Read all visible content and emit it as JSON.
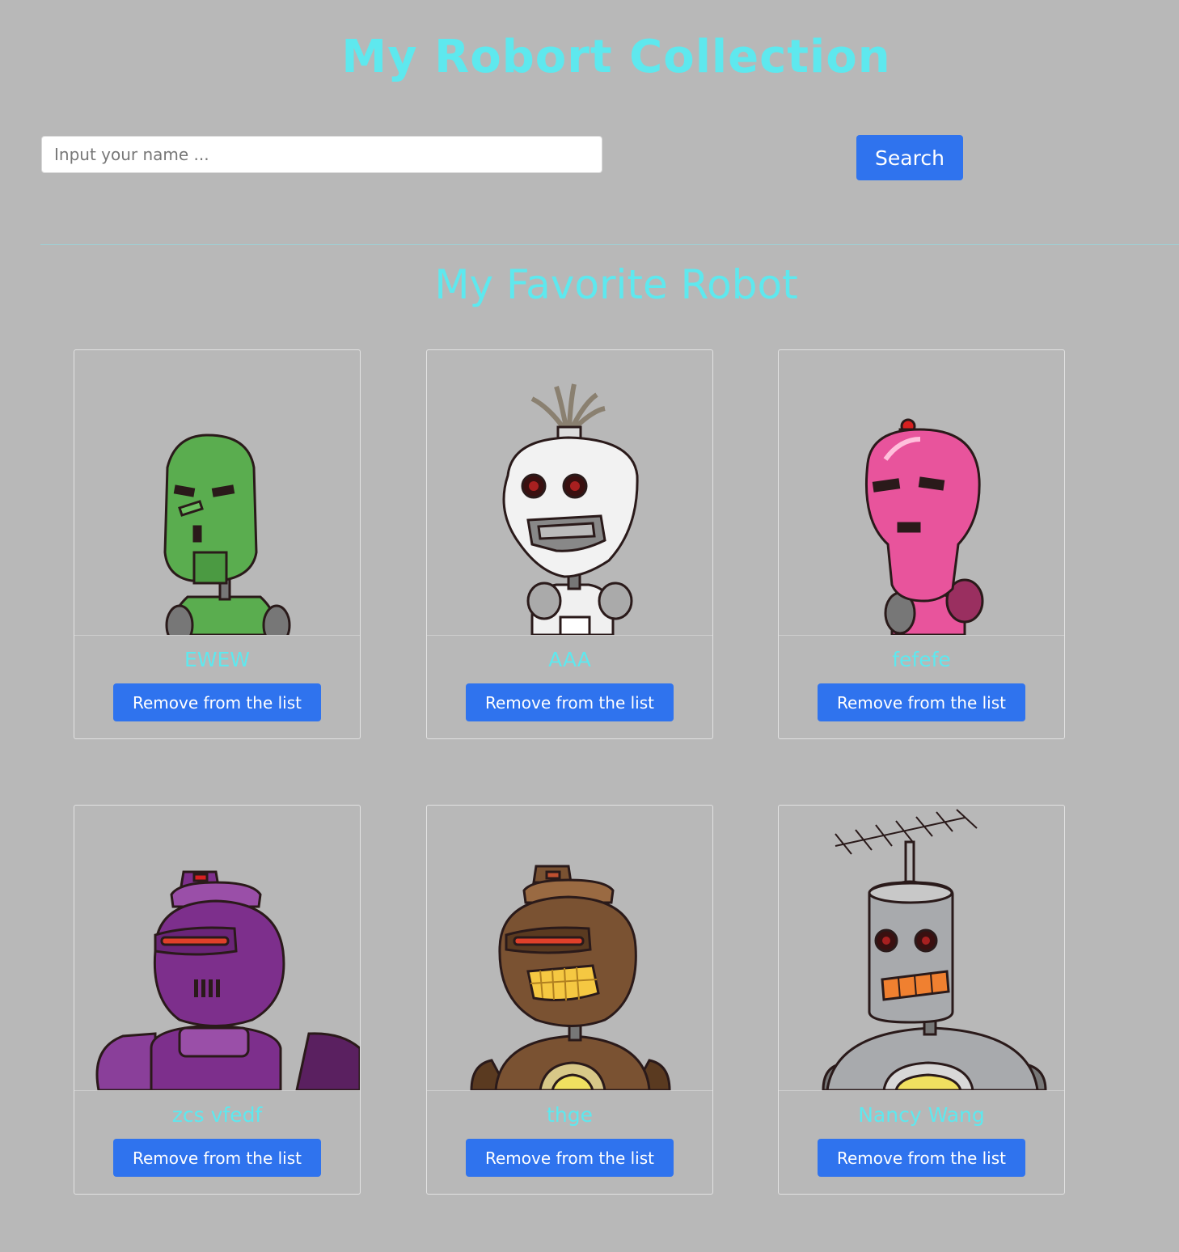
{
  "header": {
    "title": "My Robort Collection"
  },
  "search": {
    "placeholder": "Input your name ...",
    "value": "",
    "button_label": "Search"
  },
  "favorites": {
    "title": "My Favorite Robot",
    "remove_label": "Remove from the list",
    "robots": [
      {
        "name": "EWEW",
        "color": "#5aad4f",
        "style": "green-robot"
      },
      {
        "name": "AAA",
        "color": "#f2f2f2",
        "style": "white-robot"
      },
      {
        "name": "fefefe",
        "color": "#e8549c",
        "style": "pink-robot"
      },
      {
        "name": "zcs vfedf",
        "color": "#7d2f8c",
        "style": "purple-robot"
      },
      {
        "name": "thge",
        "color": "#7a5232",
        "style": "brown-robot"
      },
      {
        "name": "Nancy Wang",
        "color": "#a8aaad",
        "style": "gray-robot"
      }
    ]
  },
  "colors": {
    "background": "#b8b8b8",
    "accent_text": "#5ee8ee",
    "button": "#2f73ee"
  }
}
